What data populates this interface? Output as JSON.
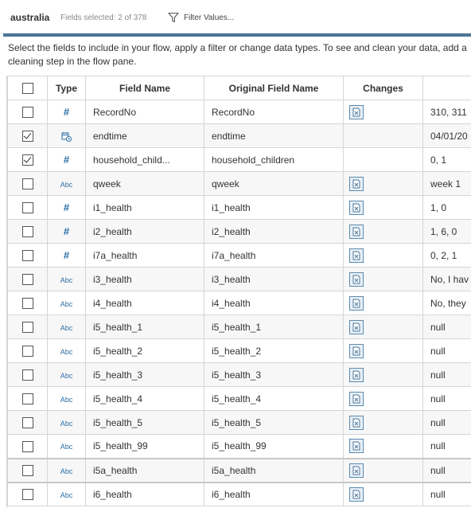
{
  "header": {
    "datasource": "australia",
    "fields_selected": "Fields selected: 2 of 378",
    "filter_label": "Filter Values..."
  },
  "instructions": "Select the fields to include in your flow, apply a filter or change data types. To see and clean your data, add a cleaning step in the flow pane.",
  "columns": {
    "type": "Type",
    "field_name": "Field Name",
    "original_field_name": "Original Field Name",
    "changes": "Changes"
  },
  "colors": {
    "accent": "#4b7699",
    "type_icon": "#2d6fa5"
  },
  "rows": [
    {
      "checked": false,
      "type": "number",
      "type_label": "#",
      "field": "RecordNo",
      "original": "RecordNo",
      "has_change": true,
      "sample": "310, 311"
    },
    {
      "checked": true,
      "type": "datetime",
      "type_label": "",
      "field": "endtime",
      "original": "endtime",
      "has_change": false,
      "sample": "04/01/20"
    },
    {
      "checked": true,
      "type": "number",
      "type_label": "#",
      "field": "household_child...",
      "original": "household_children",
      "has_change": false,
      "sample": "0, 1"
    },
    {
      "checked": false,
      "type": "string",
      "type_label": "Abc",
      "field": "qweek",
      "original": "qweek",
      "has_change": true,
      "sample": "week 1"
    },
    {
      "checked": false,
      "type": "number",
      "type_label": "#",
      "field": "i1_health",
      "original": "i1_health",
      "has_change": true,
      "sample": "1, 0"
    },
    {
      "checked": false,
      "type": "number",
      "type_label": "#",
      "field": "i2_health",
      "original": "i2_health",
      "has_change": true,
      "sample": "1, 6, 0"
    },
    {
      "checked": false,
      "type": "number",
      "type_label": "#",
      "field": "i7a_health",
      "original": "i7a_health",
      "has_change": true,
      "sample": "0, 2, 1"
    },
    {
      "checked": false,
      "type": "string",
      "type_label": "Abc",
      "field": "i3_health",
      "original": "i3_health",
      "has_change": true,
      "sample": "No, I hav"
    },
    {
      "checked": false,
      "type": "string",
      "type_label": "Abc",
      "field": "i4_health",
      "original": "i4_health",
      "has_change": true,
      "sample": "No, they"
    },
    {
      "checked": false,
      "type": "string",
      "type_label": "Abc",
      "field": "i5_health_1",
      "original": "i5_health_1",
      "has_change": true,
      "sample": "null"
    },
    {
      "checked": false,
      "type": "string",
      "type_label": "Abc",
      "field": "i5_health_2",
      "original": "i5_health_2",
      "has_change": true,
      "sample": "null"
    },
    {
      "checked": false,
      "type": "string",
      "type_label": "Abc",
      "field": "i5_health_3",
      "original": "i5_health_3",
      "has_change": true,
      "sample": "null"
    },
    {
      "checked": false,
      "type": "string",
      "type_label": "Abc",
      "field": "i5_health_4",
      "original": "i5_health_4",
      "has_change": true,
      "sample": "null"
    },
    {
      "checked": false,
      "type": "string",
      "type_label": "Abc",
      "field": "i5_health_5",
      "original": "i5_health_5",
      "has_change": true,
      "sample": "null"
    },
    {
      "checked": false,
      "type": "string",
      "type_label": "Abc",
      "field": "i5_health_99",
      "original": "i5_health_99",
      "has_change": true,
      "sample": "null"
    },
    {
      "checked": false,
      "type": "string",
      "type_label": "Abc",
      "field": "i5a_health",
      "original": "i5a_health",
      "has_change": true,
      "sample": "null"
    },
    {
      "checked": false,
      "type": "string",
      "type_label": "Abc",
      "field": "i6_health",
      "original": "i6_health",
      "has_change": true,
      "sample": "null"
    }
  ]
}
